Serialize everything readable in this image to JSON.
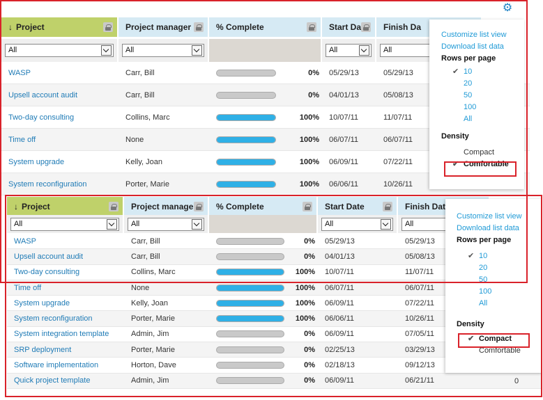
{
  "columns": {
    "project": "Project",
    "manager": "Project manager",
    "complete": "% Complete",
    "start": "Start Date",
    "finish_full": "Finish Date",
    "finish_cut": "Finish Da"
  },
  "filter_value": "All",
  "rows": [
    {
      "name": "WASP",
      "manager": "Carr, Bill",
      "pct": "0%",
      "frac": 0,
      "start": "05/29/13",
      "finish": "05/29/13"
    },
    {
      "name": "Upsell account audit",
      "manager": "Carr, Bill",
      "pct": "0%",
      "frac": 0,
      "start": "04/01/13",
      "finish": "05/08/13"
    },
    {
      "name": "Two-day consulting",
      "manager": "Collins, Marc",
      "pct": "100%",
      "frac": 1,
      "start": "10/07/11",
      "finish": "11/07/11"
    },
    {
      "name": "Time off",
      "manager": "None",
      "pct": "100%",
      "frac": 1,
      "start": "06/07/11",
      "finish": "06/07/11"
    },
    {
      "name": "System upgrade",
      "manager": "Kelly, Joan",
      "pct": "100%",
      "frac": 1,
      "start": "06/09/11",
      "finish": "07/22/11"
    },
    {
      "name": "System reconfiguration",
      "manager": "Porter, Marie",
      "pct": "100%",
      "frac": 1,
      "start": "06/06/11",
      "finish": "10/26/11"
    },
    {
      "name": "System integration template",
      "manager": "Admin, Jim",
      "pct": "0%",
      "frac": 0,
      "start": "06/09/11",
      "finish": "07/05/11"
    },
    {
      "name": "SRP deployment",
      "manager": "Porter, Marie",
      "pct": "0%",
      "frac": 0,
      "start": "02/25/13",
      "finish": "03/29/13"
    },
    {
      "name": "Software implementation",
      "manager": "Horton, Dave",
      "pct": "0%",
      "frac": 0,
      "start": "02/18/13",
      "finish": "09/12/13"
    },
    {
      "name": "Quick project template",
      "manager": "Admin, Jim",
      "pct": "0%",
      "frac": 0,
      "start": "06/09/11",
      "finish": "06/21/11",
      "extra": "0"
    }
  ],
  "menu": {
    "customize": "Customize list view",
    "download": "Download list data",
    "rows_per_page": "Rows per page",
    "rows_options": [
      "10",
      "20",
      "50",
      "100",
      "All"
    ],
    "density": "Density",
    "compact": "Compact",
    "comfortable": "Comfortable",
    "check_mark": "✔"
  },
  "colors": {
    "project_header_bg": "#bfd16a",
    "header_bg": "#d6eaf4",
    "link": "#1f7bb6",
    "progress_fill": "#2fb0e6",
    "progress_empty": "#c9c9c9",
    "highlight": "#d9222a"
  },
  "icons": {
    "gear": "gear-icon",
    "lock": "lock-icon",
    "sort_arrow": "↓",
    "dropdown": "chevron-down-icon"
  }
}
